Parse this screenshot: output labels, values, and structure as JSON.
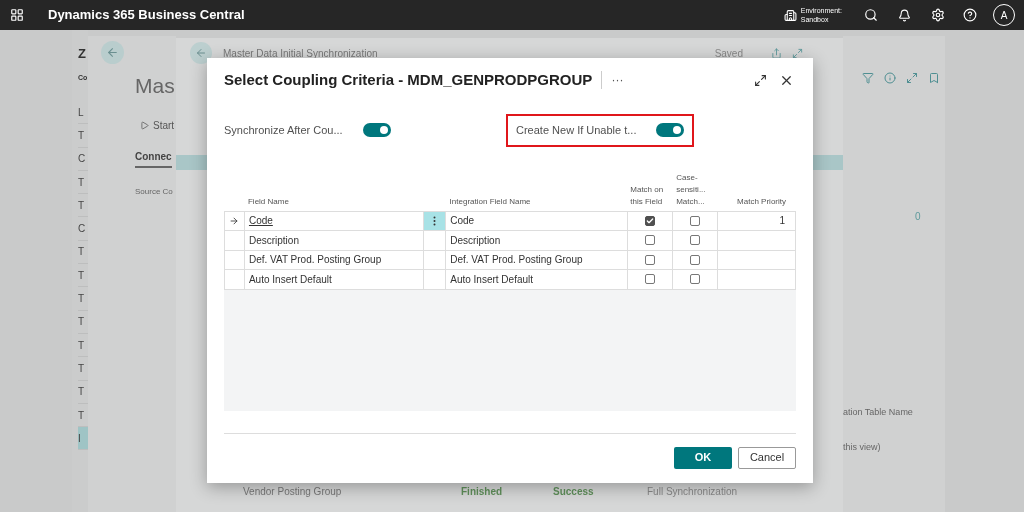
{
  "top_bar": {
    "app_name": "Dynamics 365 Business Central",
    "environment_label": "Environment:",
    "environment_value": "Sandbox",
    "avatar": "A"
  },
  "back_page": {
    "title_letter": "Z",
    "subtitle": "Co",
    "left_column": [
      {
        "text": "L",
        "selected": false
      },
      {
        "text": "T",
        "selected": false
      },
      {
        "text": "C",
        "selected": false
      },
      {
        "text": "T",
        "selected": false
      },
      {
        "text": "T",
        "selected": false
      },
      {
        "text": "C",
        "selected": false
      },
      {
        "text": "T",
        "selected": false
      },
      {
        "text": "T",
        "selected": false
      },
      {
        "text": "T",
        "selected": false
      },
      {
        "text": "T",
        "selected": false
      },
      {
        "text": "T",
        "selected": false
      },
      {
        "text": "T",
        "selected": false
      },
      {
        "text": "T",
        "selected": false
      },
      {
        "text": "T",
        "selected": false
      },
      {
        "text": "I",
        "selected": true
      }
    ]
  },
  "middle_page": {
    "title": "Mas",
    "action": "Start",
    "tab": "Connec",
    "field": "Source Co",
    "right_value": "0",
    "right_column_header": "ation Table Name",
    "right_note": "this view)"
  },
  "sync_page": {
    "title": "Master Data Initial Synchronization",
    "status": "Saved",
    "row": {
      "name": "Vendor Posting Group",
      "job_status": "Finished",
      "result": "Success",
      "type": "Full Synchronization"
    }
  },
  "dialog": {
    "title": "Select Coupling Criteria - MDM_GENPRODPGROUP",
    "more": "···",
    "toggles": [
      {
        "label": "Synchronize After Cou...",
        "on": true,
        "highlighted": false
      },
      {
        "label": "Create New If Unable t...",
        "on": true,
        "highlighted": true
      }
    ],
    "table": {
      "columns": [
        "Field Name",
        "Integration Field Name",
        "Match on this Field",
        "Case-sensiti... Match...",
        "Match Priority"
      ],
      "rows": [
        {
          "field_name": "Code",
          "integration_field_name": "Code",
          "match": true,
          "case_sensitive": false,
          "priority": "1",
          "selected": true
        },
        {
          "field_name": "Description",
          "integration_field_name": "Description",
          "match": false,
          "case_sensitive": false,
          "selected": false
        },
        {
          "field_name": "Def. VAT Prod. Posting Group",
          "integration_field_name": "Def. VAT Prod. Posting Group",
          "match": false,
          "case_sensitive": false,
          "selected": false
        },
        {
          "field_name": "Auto Insert Default",
          "integration_field_name": "Auto Insert Default",
          "match": false,
          "case_sensitive": false,
          "selected": false
        }
      ]
    },
    "buttons": [
      {
        "label": "OK",
        "kind": "primary"
      },
      {
        "label": "Cancel",
        "kind": "secondary"
      }
    ]
  }
}
